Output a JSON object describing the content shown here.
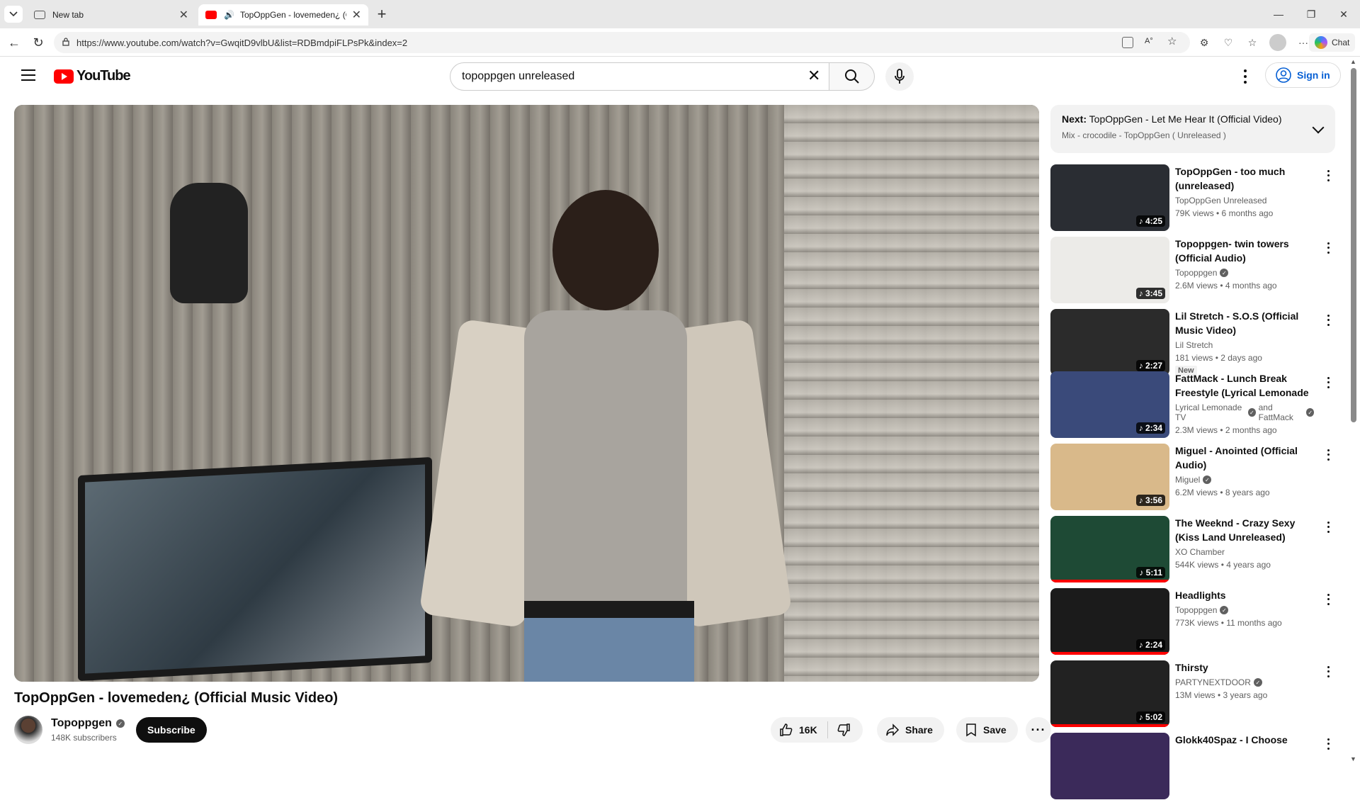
{
  "browser": {
    "tabs": [
      {
        "title": "New tab",
        "active": false
      },
      {
        "title": "TopOppGen - lovemeden¿ (Of",
        "active": true
      }
    ],
    "url": "https://www.youtube.com/watch?v=GwqitD9vlbU&list=RDBmdpiFLPsPk&index=2",
    "chat_label": "Chat"
  },
  "header": {
    "logo_text": "YouTube",
    "search_value": "topoppgen unreleased",
    "sign_in_label": "Sign in"
  },
  "video": {
    "title": "TopOppGen - lovemeden¿ (Official Music Video)",
    "channel_name": "Topoppgen",
    "subscribers": "148K subscribers",
    "subscribe_label": "Subscribe",
    "likes": "16K",
    "share_label": "Share",
    "save_label": "Save"
  },
  "next_up": {
    "prefix": "Next:",
    "title": "TopOppGen - Let Me Hear It (Official Video)",
    "subtitle": "Mix - crocodile - TopOppGen ( Unreleased )"
  },
  "recommendations": [
    {
      "title": "TopOppGen -  too much (unreleased)",
      "channel": "TopOppGen Unreleased",
      "verified": false,
      "meta": "79K views • 6 months ago",
      "duration": "4:25",
      "badge": "",
      "thumb_color": "#2a2d33",
      "watched": false
    },
    {
      "title": "Topoppgen- twin towers (Official Audio)",
      "channel": "Topoppgen",
      "verified": true,
      "meta": "2.6M views • 4 months ago",
      "duration": "3:45",
      "badge": "",
      "thumb_color": "#ecebe8",
      "watched": false
    },
    {
      "title": "Lil Stretch - S.O.S (Official Music Video)",
      "channel": "Lil Stretch",
      "verified": false,
      "meta": "181 views • 2 days ago",
      "duration": "2:27",
      "badge": "New",
      "thumb_color": "#2b2b2b",
      "watched": false
    },
    {
      "title": "FattMack - Lunch Break Freestyle (Lyrical Lemonade ...",
      "channel": "Lyrical Lemonade TV",
      "verified": true,
      "channel_extra": "and FattMack",
      "meta": "2.3M views • 2 months ago",
      "duration": "2:34",
      "badge": "",
      "thumb_color": "#3a4a7a",
      "watched": false
    },
    {
      "title": "Miguel - Anointed (Official Audio)",
      "channel": "Miguel",
      "verified": true,
      "meta": "6.2M views • 8 years ago",
      "duration": "3:56",
      "badge": "",
      "thumb_color": "#d9b98a",
      "watched": false
    },
    {
      "title": "The Weeknd - Crazy Sexy (Kiss Land Unreleased)",
      "channel": "XO Chamber",
      "verified": false,
      "meta": "544K views • 4 years ago",
      "duration": "5:11",
      "badge": "",
      "thumb_color": "#1e4a35",
      "watched": true
    },
    {
      "title": "Headlights",
      "channel": "Topoppgen",
      "verified": true,
      "meta": "773K views • 11 months ago",
      "duration": "2:24",
      "badge": "",
      "thumb_color": "#1b1b1b",
      "watched": true
    },
    {
      "title": "Thirsty",
      "channel": "PARTYNEXTDOOR",
      "verified": true,
      "meta": "13M views • 3 years ago",
      "duration": "5:02",
      "badge": "",
      "thumb_color": "#222222",
      "watched": true
    },
    {
      "title": "Glokk40Spaz - I Choose",
      "channel": "",
      "verified": false,
      "meta": "",
      "duration": "",
      "badge": "",
      "thumb_color": "#3b2a5a",
      "watched": false
    }
  ]
}
